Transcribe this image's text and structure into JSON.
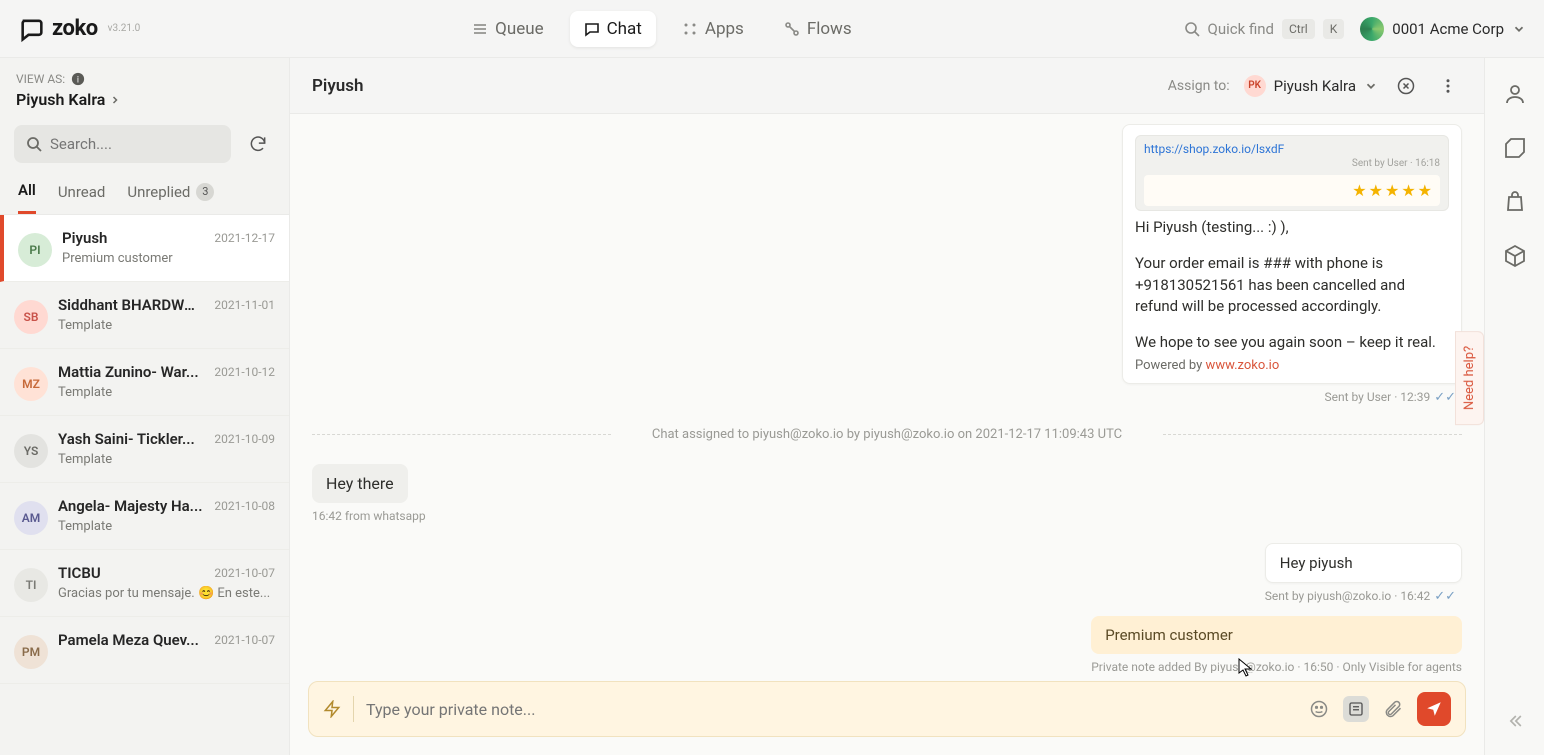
{
  "app": {
    "name": "zoko",
    "version": "v3.21.0"
  },
  "nav": {
    "items": [
      {
        "key": "queue",
        "label": "Queue"
      },
      {
        "key": "chat",
        "label": "Chat",
        "active": true
      },
      {
        "key": "apps",
        "label": "Apps"
      },
      {
        "key": "flows",
        "label": "Flows"
      }
    ],
    "quickFind": {
      "placeholder": "Quick find",
      "kbd1": "Ctrl",
      "kbd2": "K"
    },
    "org": {
      "name": "0001 Acme Corp"
    }
  },
  "sidebar": {
    "viewAsLabel": "VIEW AS:",
    "viewAsValue": "Piyush Kalra",
    "searchPlaceholder": "Search....",
    "tabs": [
      {
        "key": "all",
        "label": "All",
        "active": true
      },
      {
        "key": "unread",
        "label": "Unread"
      },
      {
        "key": "unreplied",
        "label": "Unreplied",
        "badge": "3"
      }
    ],
    "conversations": [
      {
        "initials": "PI",
        "color": "#d7ecd7",
        "fg": "#4a7a4a",
        "name": "Piyush",
        "date": "2021-12-17",
        "preview": "Premium customer",
        "active": true
      },
      {
        "initials": "SB",
        "color": "#ffd9d2",
        "fg": "#c9534a",
        "name": "Siddhant BHARDWA...",
        "date": "2021-11-01",
        "preview": "Template"
      },
      {
        "initials": "MZ",
        "color": "#ffe2d6",
        "fg": "#c76a3a",
        "name": "Mattia Zunino- War...",
        "date": "2021-10-12",
        "preview": "Template"
      },
      {
        "initials": "YS",
        "color": "#e3e3e0",
        "fg": "#6b6b66",
        "name": "Yash Saini- Tickler...",
        "date": "2021-10-09",
        "preview": "Template"
      },
      {
        "initials": "AM",
        "color": "#e0e0ef",
        "fg": "#5a5a90",
        "name": "Angela- Majesty Ha...",
        "date": "2021-10-08",
        "preview": "Template"
      },
      {
        "initials": "TI",
        "color": "#e8e8e4",
        "fg": "#7a7a75",
        "name": "TICBU",
        "date": "2021-10-07",
        "preview": "Gracias por tu mensaje. 😊 En este..."
      },
      {
        "initials": "PM",
        "color": "#efe2d6",
        "fg": "#8a6b4a",
        "name": "Pamela Meza Quev...",
        "date": "2021-10-07",
        "preview": ""
      }
    ]
  },
  "chat": {
    "title": "Piyush",
    "assignLabel": "Assign to:",
    "assignee": {
      "initials": "PK",
      "name": "Piyush Kalra"
    },
    "messages": {
      "linkPreview": {
        "url": "https://shop.zoko.io/lsxdF",
        "meta": "Sent by User · 16:18"
      },
      "card": {
        "greeting": "Hi Piyush (testing... :) ),",
        "body1": "Your order email is ### with phone is +918130521561 has been cancelled and refund will be processed accordingly.",
        "body2": "We hope to see you again soon – keep it real.",
        "poweredLabel": "Powered by ",
        "poweredLink": "www.zoko.io",
        "meta": "Sent by User · 12:39"
      },
      "system": "Chat assigned to piyush@zoko.io by piyush@zoko.io on 2021-12-17 11:09:43 UTC",
      "incoming": {
        "text": "Hey there",
        "meta": "16:42 from whatsapp"
      },
      "outgoing": {
        "text": "Hey piyush",
        "meta": "Sent by piyush@zoko.io · 16:42"
      },
      "note": {
        "text": "Premium customer",
        "meta": "Private note added By piyush@zoko.io · 16:50 · Only Visible for agents"
      }
    },
    "composer": {
      "placeholder": "Type your private note..."
    }
  },
  "needHelp": "Need help?"
}
